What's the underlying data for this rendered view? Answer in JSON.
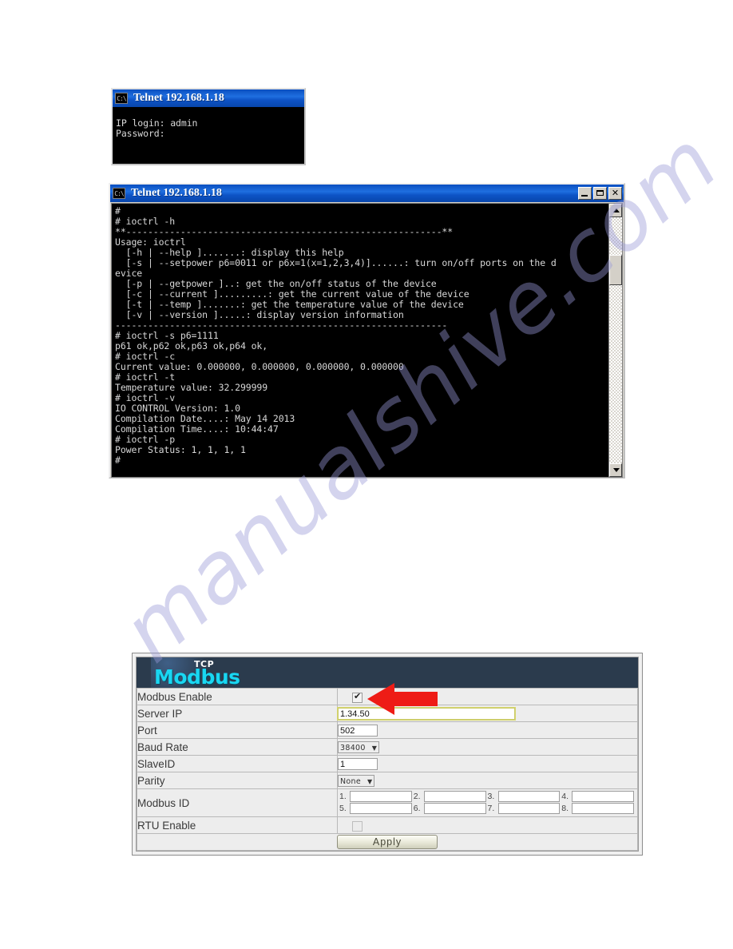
{
  "watermark": {
    "text": "manualshive.com"
  },
  "telnet_login": {
    "icon": "console-icon",
    "title": "Telnet 192.168.1.18",
    "screen_text": "IP login: admin\nPassword:"
  },
  "telnet_main": {
    "icon": "console-icon",
    "title": "Telnet 192.168.1.18",
    "buttons": {
      "minimize": "minimize-button",
      "maximize": "maximize-button",
      "close": "✕"
    },
    "screen_text": "#\n# ioctrl -h\n**----------------------------------------------------------**\nUsage: ioctrl\n  [-h | --help ].......: display this help\n  [-s | --setpower p6=0011 or p6x=1(x=1,2,3,4)]......: turn on/off ports on the d\nevice\n  [-p | --getpower ]..: get the on/off status of the device\n  [-c | --current ].........: get the current value of the device\n  [-t | --temp ].......: get the temperature value of the device\n  [-v | --version ].....: display version information\n-------------------------------------------------------------\n# ioctrl -s p6=1111\np61 ok,p62 ok,p63 ok,p64 ok,\n# ioctrl -c\nCurrent value: 0.000000, 0.000000, 0.000000, 0.000000\n# ioctrl -t\nTemperature value: 32.299999\n# ioctrl -v\nIO CONTROL Version: 1.0\nCompilation Date....: May 14 2013\nCompilation Time....: 10:44:47\n# ioctrl -p\nPower Status: 1, 1, 1, 1\n#"
  },
  "modbus": {
    "header": {
      "eyebrow": "TCP",
      "title": "Modbus",
      "title_color": "#19d7f2"
    },
    "rows": {
      "modbus_enable": {
        "label": "Modbus Enable",
        "checked": true
      },
      "server_ip": {
        "label": "Server IP",
        "value": "1.34.50"
      },
      "port": {
        "label": "Port",
        "value": "502"
      },
      "baud_rate": {
        "label": "Baud Rate",
        "value": "38400"
      },
      "slave_id": {
        "label": "SlaveID",
        "value": "1"
      },
      "parity": {
        "label": "Parity",
        "value": "None"
      },
      "modbus_id": {
        "label": "Modbus ID",
        "fields": [
          {
            "num": "1.",
            "value": ""
          },
          {
            "num": "2.",
            "value": ""
          },
          {
            "num": "3.",
            "value": ""
          },
          {
            "num": "4.",
            "value": ""
          },
          {
            "num": "5.",
            "value": ""
          },
          {
            "num": "6.",
            "value": ""
          },
          {
            "num": "7.",
            "value": ""
          },
          {
            "num": "8.",
            "value": ""
          }
        ]
      },
      "rtu_enable": {
        "label": "RTU Enable",
        "checked": false
      }
    },
    "apply_label": "Apply"
  },
  "annotation": {
    "arrow": "red-left-arrow",
    "color": "#ee1c16"
  }
}
